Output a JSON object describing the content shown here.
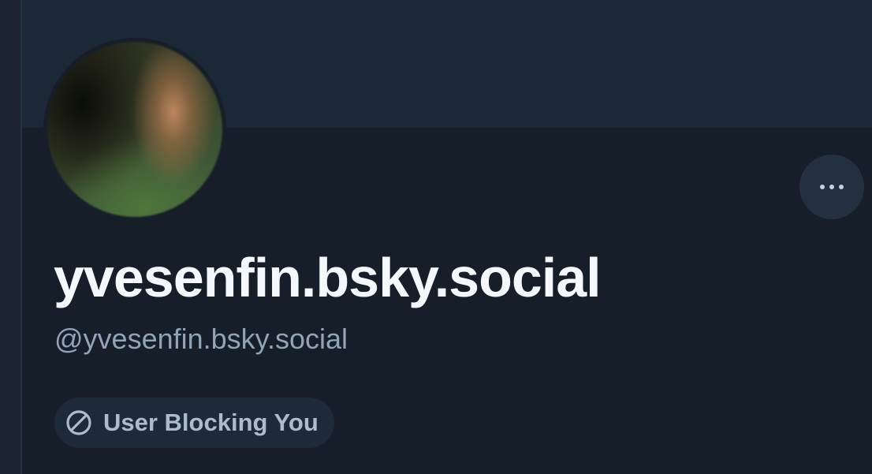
{
  "profile": {
    "display_name": "yvesenfin.bsky.social",
    "handle": "@yvesenfin.bsky.social",
    "avatar_icon": "avatar-photo-blurred"
  },
  "actions": {
    "more_icon": "ellipsis-icon"
  },
  "status": {
    "block_label": "User Blocking You",
    "block_icon": "block-icon"
  },
  "colors": {
    "background": "#161e29",
    "banner": "#1d2837",
    "badge_background": "#1e2a3a",
    "handle_text": "#93a3b8",
    "name_text": "#f4f7fb"
  }
}
